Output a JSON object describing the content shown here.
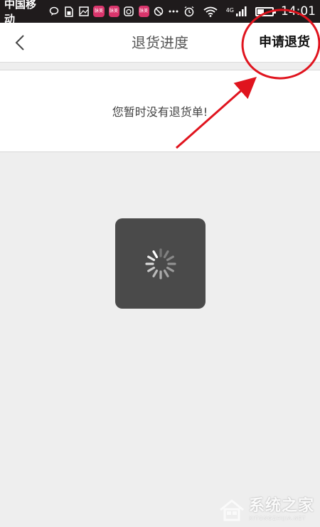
{
  "status_bar": {
    "carrier": "中国移动",
    "app_badge_label": "脉美",
    "network": "4G",
    "time": "14:01"
  },
  "nav": {
    "title": "退货进度",
    "apply_label": "申请退货"
  },
  "empty": {
    "message": "您暂时没有退货单!"
  },
  "watermark": {
    "title": "系统之家",
    "subtitle": "XITONGZHIJIA.NET"
  },
  "colors": {
    "status_bar_bg": "#1f1b1c",
    "annotation_red": "#e0141e",
    "loader_bg": "#4a4a4a",
    "page_bg": "#eeeeee"
  }
}
